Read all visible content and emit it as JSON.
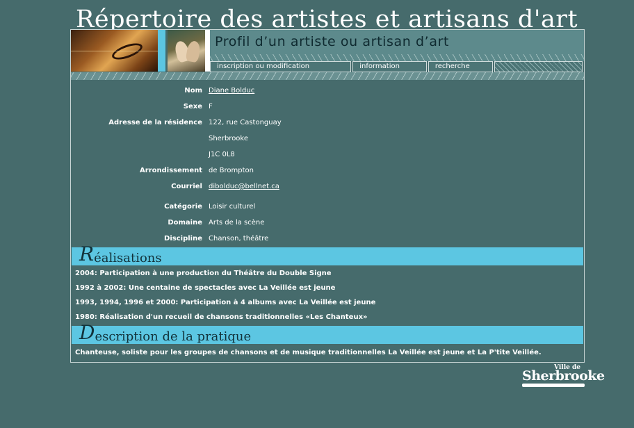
{
  "site": {
    "title": "Répertoire des artistes et artisans d'art"
  },
  "header": {
    "profile_title": "Profil d’un artiste ou artisan d’art"
  },
  "nav": {
    "items": [
      {
        "label": "inscription ou modification"
      },
      {
        "label": "information"
      },
      {
        "label": "recherche"
      }
    ]
  },
  "profile": {
    "nom": {
      "label": "Nom",
      "value": "Diane Bolduc"
    },
    "sexe": {
      "label": "Sexe",
      "value": "F"
    },
    "adresse": {
      "label": "Adresse de la résidence",
      "line1": "122, rue Castonguay",
      "line2": "Sherbrooke",
      "line3": "J1C 0L8"
    },
    "arrondissement": {
      "label": "Arrondissement",
      "value": "de Brompton"
    },
    "courriel": {
      "label": "Courriel",
      "value": "dibolduc@bellnet.ca"
    },
    "categorie": {
      "label": "Catégorie",
      "value": "Loisir culturel"
    },
    "domaine": {
      "label": "Domaine",
      "value": "Arts de la scène"
    },
    "discipline": {
      "label": "Discipline",
      "value": "Chanson, théâtre"
    }
  },
  "realisations": {
    "heading_initial": "R",
    "heading_rest": "éalisations",
    "items": [
      "2004: Participation à une production du Théâtre du Double Signe",
      "1992 à 2002: Une centaine de spectacles avec La Veillée est jeune",
      "1993, 1994, 1996 et 2000: Participation à 4 albums avec La Veillée est jeune",
      "1980: Réalisation d'un recueil de chansons traditionnelles «Les Chanteux»"
    ]
  },
  "description": {
    "heading_initial": "D",
    "heading_rest": "escription de la pratique",
    "text": "Chanteuse, soliste pour les groupes de chansons et de musique traditionnelles La Veillée est jeune et La P'tite Veillée."
  },
  "logo": {
    "ville": "Ville de",
    "name": "Sherbrooke"
  }
}
